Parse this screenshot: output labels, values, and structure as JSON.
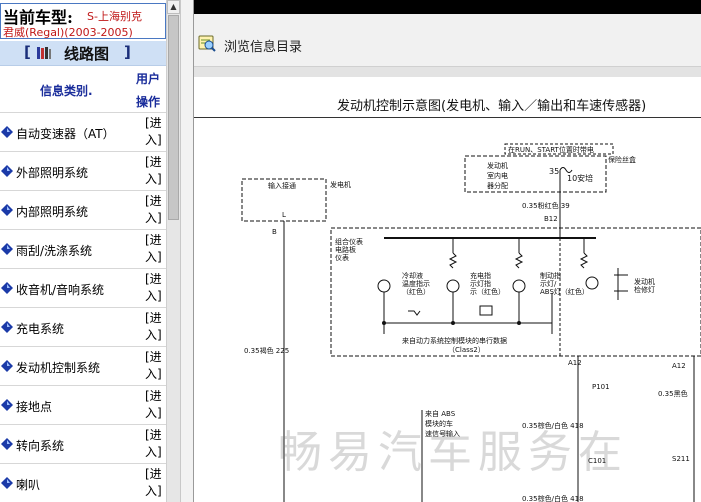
{
  "sidebar": {
    "model_label": "当前车型:",
    "model_value_line1": "S-上海别克",
    "model_value_line2": "君威(Regal)(2003-2005)",
    "bracket_open": "[",
    "bracket_close": "]",
    "section_title": "线路图",
    "col_category": "信息类别.",
    "col_user_action": "用户操作",
    "items": [
      {
        "label": "自动变速器（AT）",
        "action": "[进入]"
      },
      {
        "label": "外部照明系统",
        "action": "[进入]"
      },
      {
        "label": "内部照明系统",
        "action": "[进入]"
      },
      {
        "label": "雨刮/洗涤系统",
        "action": "[进入]"
      },
      {
        "label": "收音机/音响系统",
        "action": "[进入]"
      },
      {
        "label": "充电系统",
        "action": "[进入]"
      },
      {
        "label": "发动机控制系统",
        "action": "[进入]"
      },
      {
        "label": "接地点",
        "action": "[进入]"
      },
      {
        "label": "转向系统",
        "action": "[进入]"
      },
      {
        "label": "喇叭",
        "action": "[进入]"
      }
    ]
  },
  "main": {
    "toolbar_label": "浏览信息目录",
    "diagram_title": "发动机控制示意图(发电机、输入／输出和车速传感器)",
    "diagram": {
      "top_box": "在RUN、START位置时带电",
      "fuse_box": [
        "发动机",
        "室内电",
        "器分配"
      ],
      "fuse_num": "35",
      "fuse_amp": "10安培",
      "inspect_box": "保险丝盒",
      "wire_39": "0.35粉红色 39",
      "b12": "B12",
      "input_box": "输入接通",
      "generator": "发电机",
      "l_terminal": "L",
      "b_terminal": "B",
      "cluster": [
        "组合仪表",
        "电路板",
        "仪表"
      ],
      "coolant": [
        "冷却液",
        "温度指示",
        "（红色）"
      ],
      "charge": [
        "充电指",
        "示灯指",
        "示（红色）"
      ],
      "brake": [
        "制动指",
        "示灯/",
        "ABS灯（红色）"
      ],
      "engine_light": [
        "发动机",
        "检修灯"
      ],
      "bus_note": [
        "来自动力系统控制模块的串行数据",
        "（Class2）"
      ],
      "wire_225": "0.35褐色 225",
      "a12_left": "A12",
      "a12_right": "A12",
      "p101": "P101",
      "c101": "C101",
      "s211": "S211",
      "abs_note": [
        "来自 ABS",
        "模块的车",
        "速信号输入"
      ],
      "wire_418a": "0.35棕色/白色 418",
      "wire_418b": "0.35棕色/白色 418",
      "wire_black": "0.35黑色"
    },
    "watermark": "畅易汽车服务在"
  },
  "colors": {
    "accent_blue": "#1a2d9b",
    "model_red": "#c01818",
    "title_band": "#cfe0f5"
  }
}
